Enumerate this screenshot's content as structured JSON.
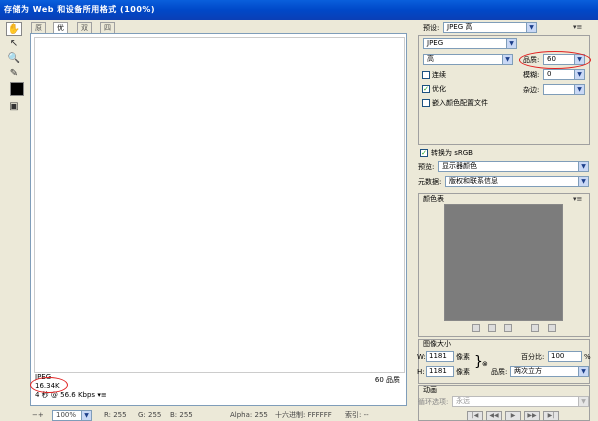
{
  "window": {
    "title": "存储为 Web 和设备所用格式 (100%)"
  },
  "tabs": [
    "原稿",
    "优化",
    "双联",
    "四联"
  ],
  "preview": {
    "format": "JPEG",
    "size": "16.34K",
    "speed": "4 秒 @ 56.6 Kbps",
    "quality_label": "60 品质",
    "menu_icon": "▾≡"
  },
  "statusbar": {
    "zoom": "100%",
    "r": "R: 255",
    "g": "G: 255",
    "b": "B: 255",
    "alpha": "Alpha: 255",
    "hex": "十六进制: FFFFFF",
    "index": "索引: --"
  },
  "settings": {
    "preset_label": "预设:",
    "preset_value": "JPEG 高",
    "format_value": "JPEG",
    "compression_value": "高",
    "quality_label": "品质:",
    "quality_value": "60",
    "progressive_label": "连续",
    "blur_label": "模糊:",
    "blur_value": "0",
    "optimized_label": "优化",
    "matte_label": "杂边:",
    "embed_profile_label": "嵌入颜色配置文件",
    "convert_srgb_label": "转换为 sRGB",
    "preview_label": "预览:",
    "preview_value": "显示器颜色",
    "metadata_label": "元数据:",
    "metadata_value": "版权和联系信息"
  },
  "color_table": {
    "title": "颜色表",
    "swatch_color": "#7c7c7c"
  },
  "image_size": {
    "title": "图像大小",
    "w_label": "W:",
    "w_value": "1181",
    "h_label": "H:",
    "h_value": "1181",
    "unit": "像素",
    "percent_label": "百分比:",
    "percent_value": "100",
    "percent_unit": "%",
    "quality_label": "品质:",
    "quality_value": "两次立方"
  },
  "animation": {
    "title": "动画",
    "loop_label": "循环选项:",
    "loop_value": "永远"
  }
}
